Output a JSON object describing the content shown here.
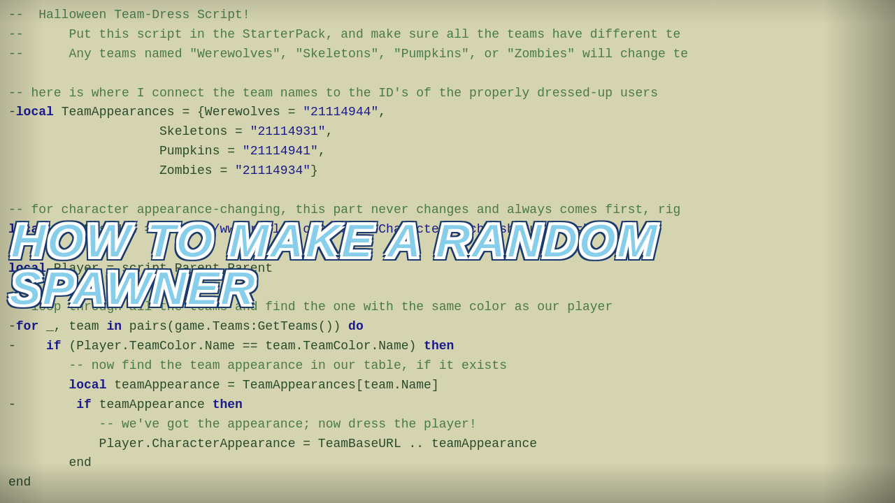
{
  "title": "HOW TO MAKE A RANDOM SPAWNER",
  "code": {
    "lines": [
      {
        "text": "--  Halloween Team-Dress Script!",
        "type": "comment"
      },
      {
        "text": "--      Put this script in the StarterPack, and make sure all the teams have different te",
        "type": "comment"
      },
      {
        "text": "--      Any teams named \"Werewolves\", \"Skeletons\", \"Pumpkins\", or \"Zombies\" will change te",
        "type": "comment"
      },
      {
        "text": "",
        "type": "blank"
      },
      {
        "text": "-- here is where I connect the team names to the ID's of the properly dressed-up users",
        "type": "comment"
      },
      {
        "text": "-local TeamAppearances = {Werewolves = \"21114944\",",
        "type": "code"
      },
      {
        "text": "                    Skeletons = \"21114931\",",
        "type": "code"
      },
      {
        "text": "                    Pumpkins = \"21114941\",",
        "type": "code"
      },
      {
        "text": "                    Zombies = \"21114934\"}",
        "type": "code"
      },
      {
        "text": "",
        "type": "blank"
      },
      {
        "text": "-- for character appearance-changing, this part never changes and always comes first, rig",
        "type": "comment"
      },
      {
        "text": "local TeamBaseURL = \"http://www.roblox.com/Asset/CharacterFetch.ashx?userId=\",",
        "type": "code"
      },
      {
        "text": "",
        "type": "blank"
      },
      {
        "text": "local Player = script.Parent.Parent",
        "type": "code"
      },
      {
        "text": "",
        "type": "blank"
      },
      {
        "text": "-- loop through all the teams and find the one with the same color as our player",
        "type": "comment"
      },
      {
        "text": "-for _, team in pairs(game.Teams:GetTeams()) do",
        "type": "code"
      },
      {
        "text": "-    if (Player.TeamColor.Name == team.TeamColor.Name) then",
        "type": "code"
      },
      {
        "text": "        -- now find the team appearance in our table, if it exists",
        "type": "comment"
      },
      {
        "text": "        local teamAppearance = TeamAppearances[team.Name]",
        "type": "code"
      },
      {
        "text": "-        if teamAppearance then",
        "type": "code"
      },
      {
        "text": "            -- we've got the appearance; now dress the player!",
        "type": "comment"
      },
      {
        "text": "            Player.CharacterAppearance = TeamBaseURL .. teamAppearance",
        "type": "code"
      },
      {
        "text": "        end",
        "type": "code"
      },
      {
        "text": "end",
        "type": "code"
      }
    ]
  }
}
